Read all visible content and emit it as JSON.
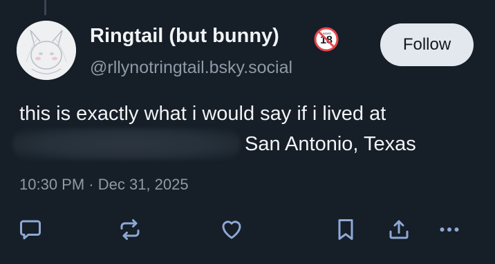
{
  "author": {
    "display_name": "Ringtail (but bunny)",
    "handle": "@rllynotringtail.bsky.social",
    "badge_icon": "adult-content-18-icon",
    "avatar_icon": "avatar-illustration"
  },
  "follow_button": {
    "label": "Follow"
  },
  "post": {
    "line1": "this is exactly what i would say if i lived at",
    "line2_visible": "San Antonio, Texas",
    "redacted": true
  },
  "timestamp": "10:30 PM · Dec 31, 2025",
  "actions": [
    {
      "name": "reply-icon"
    },
    {
      "name": "repost-icon"
    },
    {
      "name": "like-icon"
    },
    {
      "name": "bookmark-icon"
    },
    {
      "name": "share-icon"
    },
    {
      "name": "more-options-icon"
    }
  ],
  "colors": {
    "background": "#161e27",
    "text_primary": "#f1f3f5",
    "text_secondary": "#8f9aa7",
    "icon": "#8fa9d6",
    "follow_bg": "#e3e8ee",
    "badge_red": "#e5484d"
  }
}
